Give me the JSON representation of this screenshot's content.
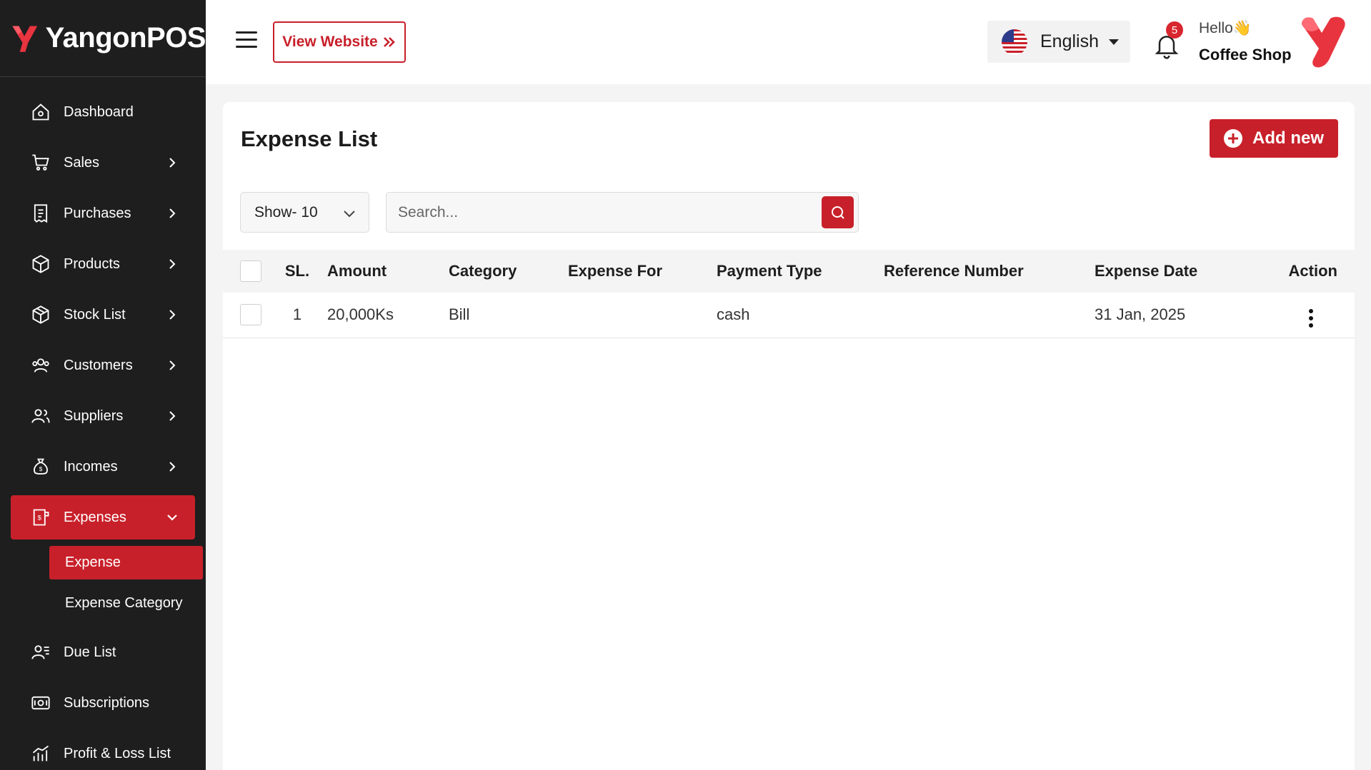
{
  "brand": {
    "name": "YangonPOS",
    "color": "#e8343f"
  },
  "colors": {
    "accent": "#c8202a",
    "sidebar_bg": "#1e1e1e",
    "page_bg": "#f4f4f4"
  },
  "sidebar": {
    "items": [
      {
        "label": "Dashboard",
        "icon": "home-icon",
        "has_children": false
      },
      {
        "label": "Sales",
        "icon": "cart-icon",
        "has_children": true
      },
      {
        "label": "Purchases",
        "icon": "receipt-icon",
        "has_children": true
      },
      {
        "label": "Products",
        "icon": "box-icon",
        "has_children": true
      },
      {
        "label": "Stock List",
        "icon": "package-icon",
        "has_children": true
      },
      {
        "label": "Customers",
        "icon": "users-icon",
        "has_children": true
      },
      {
        "label": "Suppliers",
        "icon": "supplier-icon",
        "has_children": true
      },
      {
        "label": "Incomes",
        "icon": "money-bag-icon",
        "has_children": true
      },
      {
        "label": "Expenses",
        "icon": "expense-icon",
        "has_children": true,
        "active": true,
        "expanded": true
      },
      {
        "label": "Due List",
        "icon": "due-list-icon",
        "has_children": false
      },
      {
        "label": "Subscriptions",
        "icon": "subscription-icon",
        "has_children": false
      },
      {
        "label": "Profit & Loss List",
        "icon": "chart-icon",
        "has_children": false
      }
    ],
    "expenses_sub": [
      {
        "label": "Expense",
        "active": true
      },
      {
        "label": "Expense Category",
        "active": false
      }
    ]
  },
  "header": {
    "view_website": "View Website",
    "language": "English",
    "notification_count": "5",
    "greeting": "Hello👋",
    "shop_name": "Coffee Shop"
  },
  "main": {
    "title": "Expense List",
    "add_new": "Add new",
    "show_select": "Show- 10",
    "search_placeholder": "Search...",
    "columns": [
      "SL.",
      "Amount",
      "Category",
      "Expense For",
      "Payment Type",
      "Reference Number",
      "Expense Date",
      "Action"
    ],
    "rows": [
      {
        "sl": "1",
        "amount": "20,000Ks",
        "category": "Bill",
        "expense_for": "",
        "payment_type": "cash",
        "reference": "",
        "date": "31 Jan, 2025"
      }
    ]
  }
}
